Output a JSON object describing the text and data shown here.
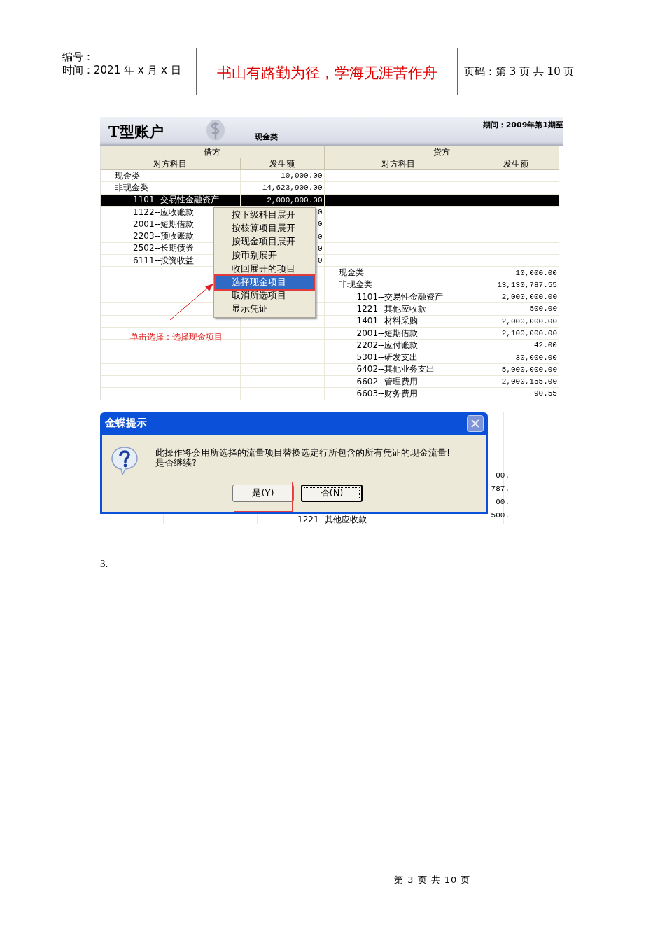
{
  "doc_header": {
    "number_label": "编号：",
    "date_line": "时间：2021 年 x 月 x 日",
    "motto": "书山有路勤为径，学海无涯苦作舟",
    "page_line": "页码：第 3 页  共 10 页"
  },
  "t_account": {
    "title": "T型账户",
    "subtitle": "现金类",
    "period": "期间：2009年第1期至",
    "groups": [
      "借方",
      "贷方"
    ],
    "columns": [
      "对方科目",
      "发生额",
      "对方科目",
      "发生额"
    ],
    "debit": [
      {
        "account": "现金类",
        "amount": "10,000.00",
        "selected": false
      },
      {
        "account": "非现金类",
        "amount": "14,623,900.00",
        "selected": false,
        "children": [
          {
            "account": "1101--交易性金融资产",
            "amount": "2,000,000.00",
            "selected": true
          },
          {
            "account": "1122--应收账款",
            "amount": "0",
            "selected": false
          },
          {
            "account": "2001--短期借款",
            "amount": "0",
            "selected": false
          },
          {
            "account": "2203--预收账款",
            "amount": "0",
            "selected": false
          },
          {
            "account": "2502--长期债券",
            "amount": "0",
            "selected": false
          },
          {
            "account": "6111--投资收益",
            "amount": "0",
            "selected": false
          }
        ]
      }
    ],
    "credit": [
      {
        "account": "现金类",
        "amount": "10,000.00",
        "selected": false
      },
      {
        "account": "非现金类",
        "amount": "13,130,787.55",
        "selected": false,
        "children": [
          {
            "account": "1101--交易性金融资产",
            "amount": "2,000,000.00",
            "selected": false
          },
          {
            "account": "1221--其他应收款",
            "amount": "500.00",
            "selected": false
          },
          {
            "account": "1401--材料采购",
            "amount": "2,000,000.00",
            "selected": false
          },
          {
            "account": "2001--短期借款",
            "amount": "2,100,000.00",
            "selected": false
          },
          {
            "account": "2202--应付账款",
            "amount": "42.00",
            "selected": false
          },
          {
            "account": "5301--研发支出",
            "amount": "30,000.00",
            "selected": false
          },
          {
            "account": "6402--其他业务支出",
            "amount": "5,000,000.00",
            "selected": false
          },
          {
            "account": "6602--管理费用",
            "amount": "2,000,155.00",
            "selected": false
          },
          {
            "account": "6603--财务费用",
            "amount": "90.55",
            "selected": false
          }
        ]
      }
    ]
  },
  "context_menu": {
    "items": [
      {
        "label": "按下级科目展开",
        "selected": false
      },
      {
        "label": "按核算项目展开",
        "selected": false
      },
      {
        "label": "按现金项目展开",
        "selected": false
      },
      {
        "label": "按币别展开",
        "selected": false
      },
      {
        "label": "收回展开的项目",
        "selected": false
      },
      {
        "label": "选择现金项目",
        "selected": true
      },
      {
        "label": "取消所选项目",
        "selected": false
      },
      {
        "label": "显示凭证",
        "selected": false
      }
    ]
  },
  "annotation": {
    "text": "单击选择：选择现金项目"
  },
  "dialog": {
    "title": "金蝶提示",
    "message": [
      "此操作将会用所选择的流量项目替换选定行所包含的所有凭证的现金流量!",
      "是否继续?"
    ],
    "buttons": [
      {
        "label": "是(Y)",
        "focused": false,
        "highlighted": true
      },
      {
        "label": "否(N)",
        "focused": true,
        "highlighted": false
      }
    ],
    "background_amounts": [
      "00.",
      "787.",
      "00.",
      "500."
    ],
    "background_account": "1221--其他应收款"
  },
  "step": "3.",
  "footer": "第 3 页 共 10 页"
}
